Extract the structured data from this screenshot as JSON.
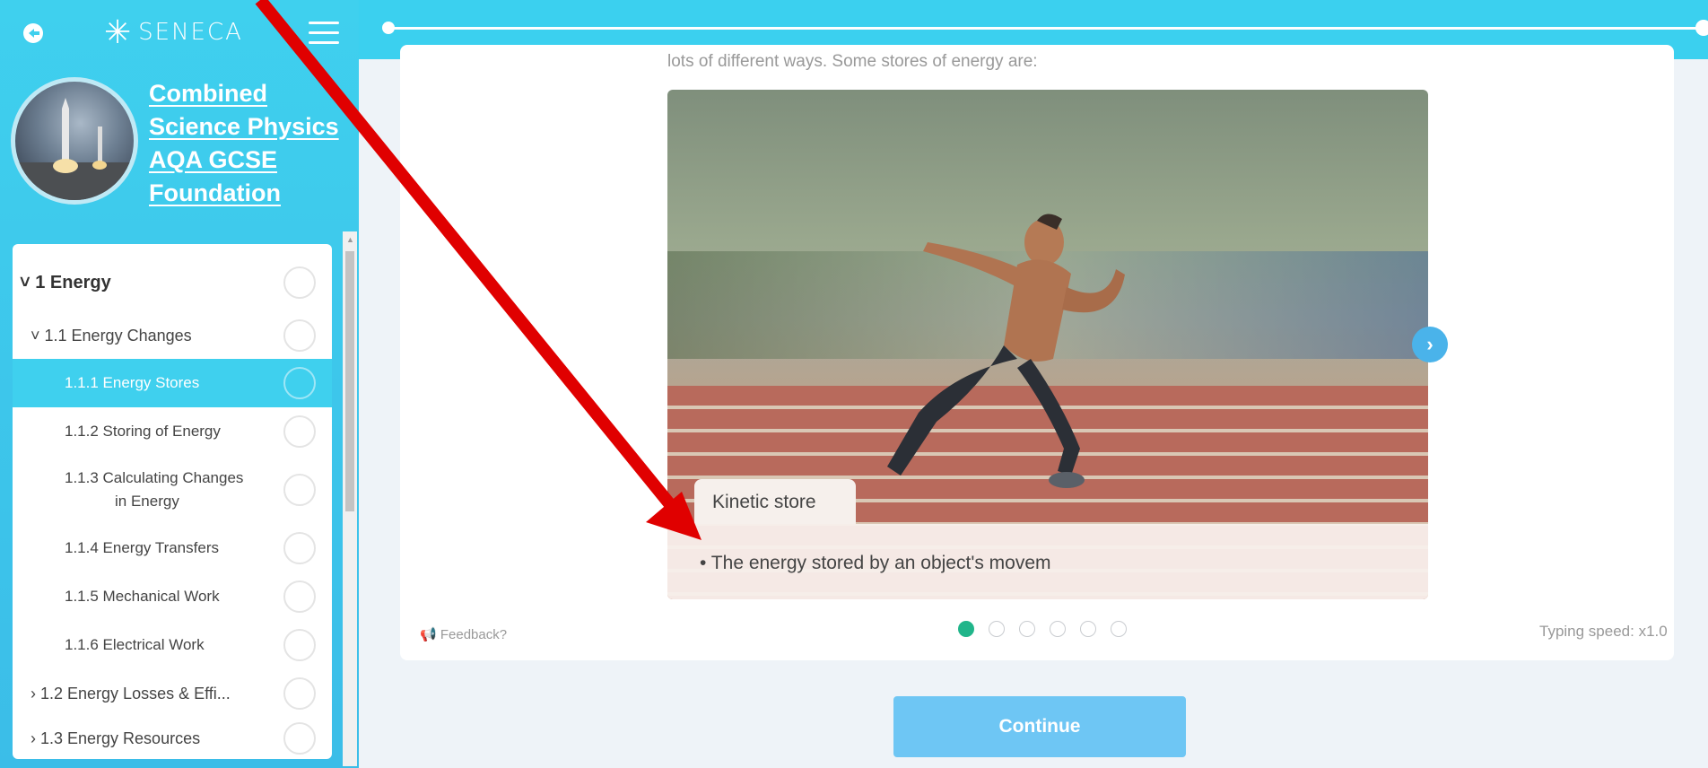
{
  "brand": {
    "name": "SENECA",
    "star": "✳"
  },
  "course": {
    "title_lines": [
      "Combined",
      "Science Physics",
      "AQA GCSE",
      "Foundation"
    ]
  },
  "tree": {
    "items": [
      {
        "label": "˅ 1 Energy",
        "level": "topic"
      },
      {
        "label": "˅ 1.1 Energy Changes",
        "level": "section"
      },
      {
        "label": "1.1.1 Energy Stores",
        "level": "lesson",
        "active": true
      },
      {
        "label": "1.1.2 Storing of Energy",
        "level": "lesson"
      },
      {
        "label_line1": "1.1.3 Calculating Changes",
        "label_line2": "in Energy",
        "level": "lesson"
      },
      {
        "label": "1.1.4 Energy Transfers",
        "level": "lesson"
      },
      {
        "label": "1.1.5 Mechanical Work",
        "level": "lesson"
      },
      {
        "label": "1.1.6 Electrical Work",
        "level": "lesson"
      },
      {
        "label": "› 1.2 Energy Losses & Effi...",
        "level": "section"
      },
      {
        "label": "› 1.3 Energy Resources",
        "level": "section"
      }
    ]
  },
  "content": {
    "intro_text": "lots of different ways. Some stores of energy are:",
    "caption_title": "Kinetic store",
    "caption_text": "• The energy stored by an object's movem",
    "next_symbol": "›",
    "feedback_label": "Feedback?",
    "typing_speed": "Typing speed: x1.0",
    "slide_count": 6,
    "active_slide": 1
  },
  "actions": {
    "continue_label": "Continue"
  },
  "colors": {
    "accent": "#3fd0ee",
    "continue": "#6ec6f4",
    "active_dot": "#20b58a",
    "annotation": "#e00000"
  }
}
